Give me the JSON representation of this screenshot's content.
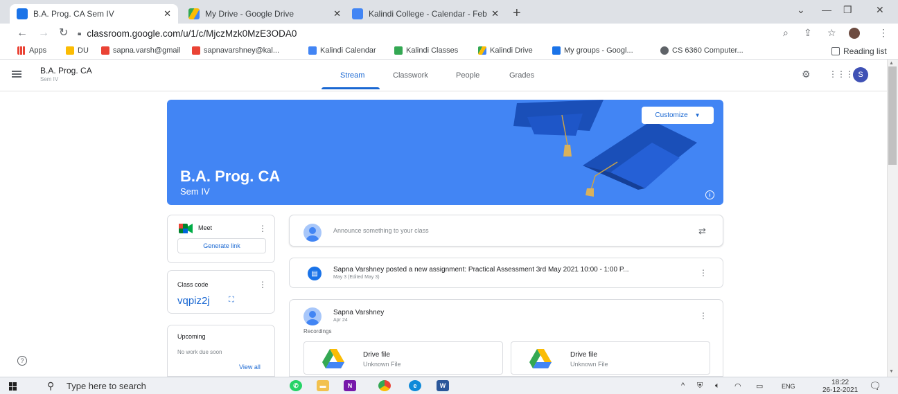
{
  "browser": {
    "tabs": [
      {
        "title": "B.A. Prog. CA Sem IV",
        "color": "#1a73e8"
      },
      {
        "title": "My Drive - Google Drive",
        "color": "#fbbc04"
      },
      {
        "title": "Kalindi College - Calendar - Febr",
        "color": "#4285f4"
      }
    ],
    "new_tab": "+",
    "url": "classroom.google.com/u/1/c/MjczMzk0MzE3ODA0",
    "bookmarks": [
      {
        "label": "Apps",
        "color": "#ea4335"
      },
      {
        "label": "DU",
        "color": "#fbbc04"
      },
      {
        "label": "sapna.varsh@gmail",
        "color": "#ea4335"
      },
      {
        "label": "sapnavarshney@kal...",
        "color": "#ea4335"
      },
      {
        "label": "Kalindi Calendar",
        "color": "#4285f4"
      },
      {
        "label": "Kalindi Classes",
        "color": "#34a853"
      },
      {
        "label": "Kalindi Drive",
        "color": "#fbbc04"
      },
      {
        "label": "My groups - Googl...",
        "color": "#1a73e8"
      },
      {
        "label": "CS 6360 Computer...",
        "color": "#5f6368"
      }
    ],
    "reading_list": "Reading list"
  },
  "classroom": {
    "class_name": "B.A. Prog. CA",
    "section": "Sem IV",
    "nav_tabs": [
      "Stream",
      "Classwork",
      "People",
      "Grades"
    ],
    "avatar_letter": "S",
    "accent": "#1967d2"
  },
  "banner": {
    "title": "B.A. Prog. CA",
    "subtitle": "Sem IV",
    "customize": "Customize",
    "color": "#4285f4"
  },
  "meet": {
    "label": "Meet",
    "generate_link": "Generate link"
  },
  "class_code": {
    "label": "Class code",
    "code": "vqpiz2j"
  },
  "upcoming": {
    "label": "Upcoming",
    "empty": "No work due soon",
    "view_all": "View all"
  },
  "stream": {
    "announce_placeholder": "Announce something to your class",
    "assignment_post": {
      "title": "Sapna Varshney posted a new assignment: Practical Assessment 3rd May 2021 10:00 - 1:00 P...",
      "date": "May 3 (Edited May 3)"
    },
    "recording_post": {
      "author": "Sapna Varshney",
      "date": "Apr 24",
      "body": "Recordings",
      "attachments": [
        {
          "name": "Drive file",
          "type": "Unknown File"
        },
        {
          "name": "Drive file",
          "type": "Unknown File"
        }
      ]
    }
  },
  "taskbar": {
    "search_placeholder": "Type here to search",
    "lang": "ENG",
    "time": "18:22",
    "date": "26-12-2021"
  }
}
